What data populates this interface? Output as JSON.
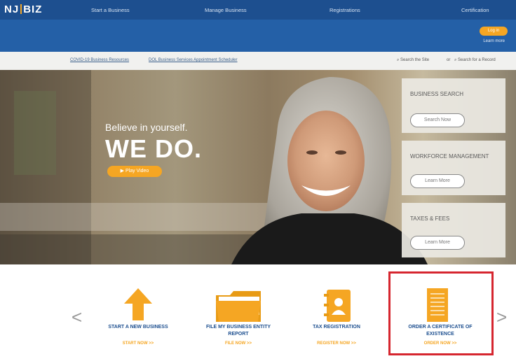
{
  "brand": {
    "logo_prefix": "NJ",
    "logo_suffix": "BIZ"
  },
  "nav": [
    "Start a Business",
    "Manage Business",
    "Registrations",
    "Certification"
  ],
  "header": {
    "login_label": "Log in",
    "login_sub": "Learn more"
  },
  "utility": {
    "links": [
      "COVID-19 Business Resources",
      "DOL Business Services Appointment Scheduler"
    ],
    "search_site": "Search the Site",
    "search_or": "or",
    "search_record": "Search for a Record"
  },
  "hero": {
    "tagline": "Believe in yourself.",
    "headline": "WE DO.",
    "play_label": "▶ Play Video"
  },
  "side_cards": [
    {
      "title": "BUSINESS SEARCH",
      "button": "Search Now"
    },
    {
      "title": "WORKFORCE MANAGEMENT",
      "button": "Learn More"
    },
    {
      "title": "TAXES & FEES",
      "button": "Learn More"
    }
  ],
  "tiles": [
    {
      "title": "START A NEW BUSINESS",
      "cta": "START NOW >>"
    },
    {
      "title": "FILE MY BUSINESS ENTITY REPORT",
      "cta": "FILE NOW >>"
    },
    {
      "title": "TAX REGISTRATION",
      "cta": "REGISTER NOW >>"
    },
    {
      "title": "ORDER A CERTIFICATE OF EXISTENCE",
      "cta": "ORDER NOW >>"
    }
  ],
  "carousel": {
    "prev": "<",
    "next": ">"
  },
  "colors": {
    "nav_blue": "#1d4f8f",
    "header_blue": "#2460a7",
    "accent_orange": "#f5a623",
    "highlight_red": "#d6262f"
  },
  "icons": [
    "up-arrow-icon",
    "folder-icon",
    "contact-book-icon",
    "document-icon",
    "search-icon",
    "play-icon"
  ]
}
